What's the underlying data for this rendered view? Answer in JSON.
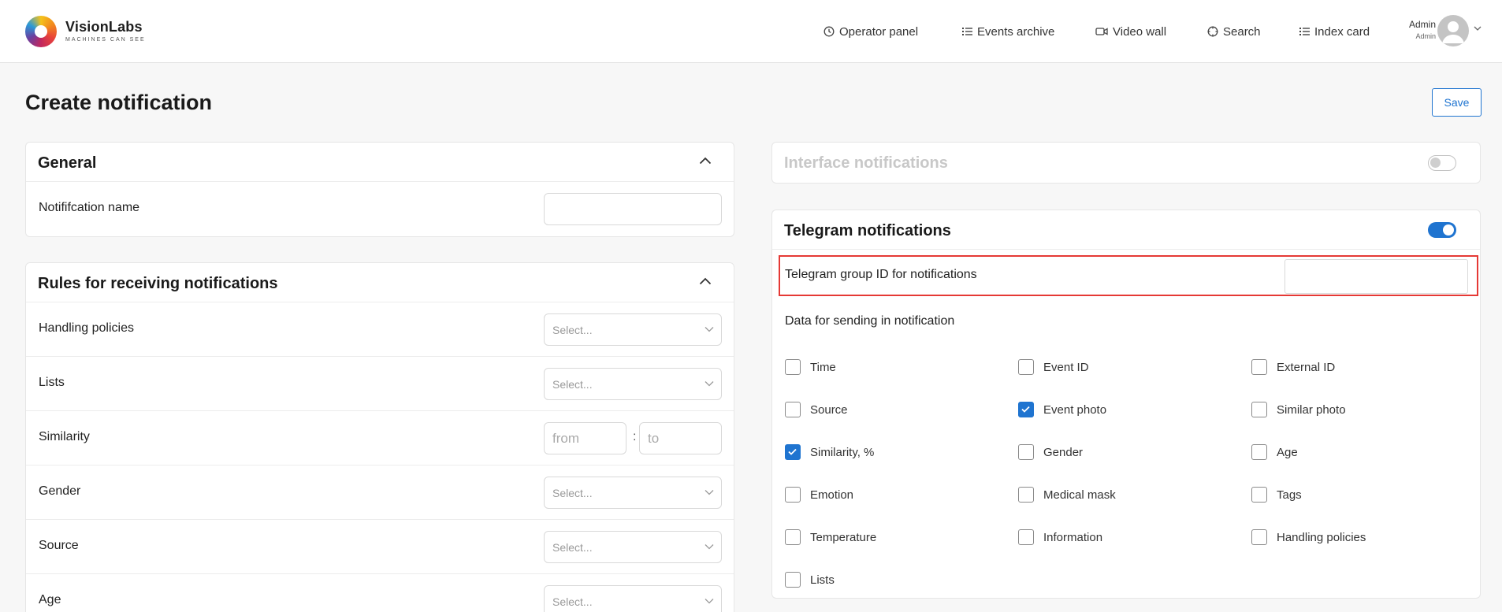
{
  "brand": {
    "name": "VisionLabs",
    "tagline": "MACHINES CAN SEE"
  },
  "nav": [
    {
      "label": "Operator panel"
    },
    {
      "label": "Events archive"
    },
    {
      "label": "Video wall"
    },
    {
      "label": "Search"
    },
    {
      "label": "Index card"
    }
  ],
  "user": {
    "name": "Admin",
    "role": "Admin"
  },
  "page": {
    "title": "Create notification",
    "save_label": "Save"
  },
  "general": {
    "title": "General",
    "name_label": "Notififcation name",
    "name_value": ""
  },
  "rules": {
    "title": "Rules for receiving notifications",
    "rows": [
      {
        "label": "Handling policies",
        "placeholder": "Select..."
      },
      {
        "label": "Lists",
        "placeholder": "Select..."
      },
      {
        "label": "Similarity",
        "from": "from",
        "to": "to",
        "separator": ":"
      },
      {
        "label": "Gender",
        "placeholder": "Select..."
      },
      {
        "label": "Source",
        "placeholder": "Select..."
      },
      {
        "label": "Age",
        "placeholder": "Select..."
      }
    ]
  },
  "interface_notifications": {
    "title": "Interface notifications",
    "enabled": false
  },
  "telegram": {
    "title": "Telegram notifications",
    "enabled": true,
    "group_id_label": "Telegram group ID for notifications",
    "group_id_value": "",
    "data_label": "Data for sending in notification",
    "fields": [
      {
        "label": "Time",
        "checked": false
      },
      {
        "label": "Event ID",
        "checked": false
      },
      {
        "label": "External ID",
        "checked": false
      },
      {
        "label": "Source",
        "checked": false
      },
      {
        "label": "Event photo",
        "checked": true
      },
      {
        "label": "Similar photo",
        "checked": false
      },
      {
        "label": "Similarity, %",
        "checked": true
      },
      {
        "label": "Gender",
        "checked": false
      },
      {
        "label": "Age",
        "checked": false
      },
      {
        "label": "Emotion",
        "checked": false
      },
      {
        "label": "Medical mask",
        "checked": false
      },
      {
        "label": "Tags",
        "checked": false
      },
      {
        "label": "Temperature",
        "checked": false
      },
      {
        "label": "Information",
        "checked": false
      },
      {
        "label": "Handling policies",
        "checked": false
      },
      {
        "label": "Lists",
        "checked": false
      }
    ]
  },
  "colors": {
    "accent": "#1f74d0",
    "highlight": "#e53935"
  }
}
